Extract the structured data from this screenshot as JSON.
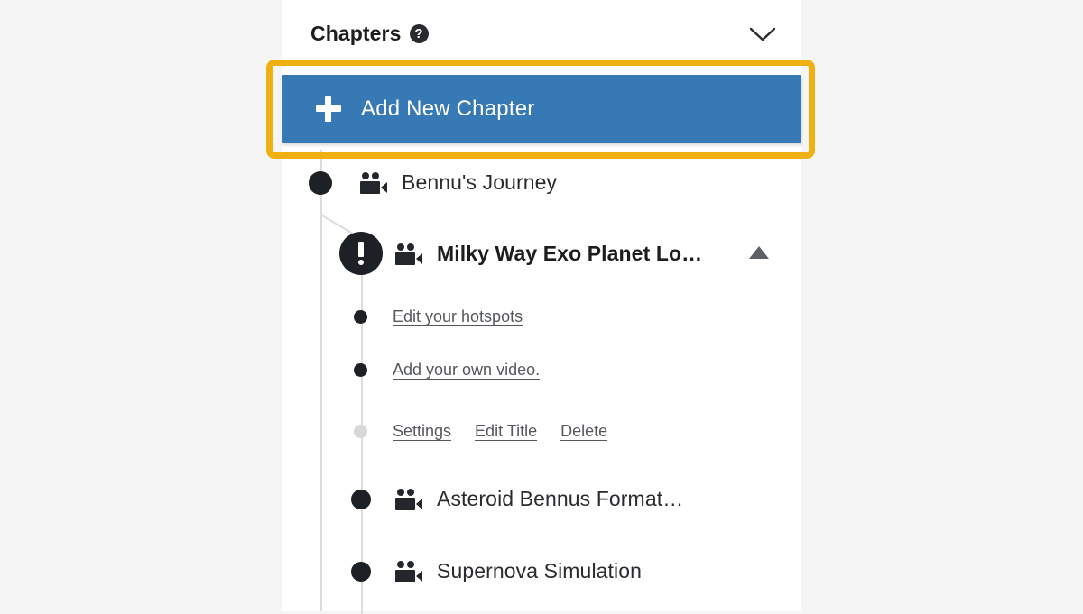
{
  "panel": {
    "header": {
      "title": "Chapters",
      "help_icon": "help-question-icon",
      "help_glyph": "?",
      "collapse_icon": "chevron-down-icon"
    },
    "add_chapter_button": {
      "label": "Add New Chapter",
      "icon": "plus-icon",
      "background_color": "#3779b4",
      "text_color": "#ffffff"
    },
    "highlight": {
      "color": "#eeb111",
      "target": "add-chapter-button"
    },
    "tree": {
      "chapters": [
        {
          "title": "Bennu's Journey",
          "icon": "video-camera-icon",
          "state": "normal",
          "bullet": "filled-dark"
        },
        {
          "title": "Milky Way Exo Planet Lo…",
          "icon": "video-camera-icon",
          "state": "active",
          "bullet": "alert-exclamation",
          "collapse_icon": "triangle-up-icon",
          "sub_items": [
            {
              "label": "Edit your hotspots",
              "bullet": "filled-dark"
            },
            {
              "label": "Add your own video.",
              "bullet": "filled-dark"
            }
          ],
          "actions": {
            "bullet": "filled-light",
            "items": [
              {
                "label": "Settings"
              },
              {
                "label": "Edit Title"
              },
              {
                "label": "Delete"
              }
            ]
          }
        },
        {
          "title": "Asteroid Bennus Format…",
          "icon": "video-camera-icon",
          "state": "normal",
          "bullet": "filled-dark"
        },
        {
          "title": "Supernova Simulation",
          "icon": "video-camera-icon",
          "state": "normal",
          "bullet": "filled-dark"
        }
      ]
    }
  },
  "colors": {
    "page_background": "#f5f5f5",
    "panel_background": "#ffffff",
    "accent_blue": "#3779b4",
    "highlight_yellow": "#eeb111",
    "node_dark": "#1d2024",
    "rail_gray": "#dcdcdc"
  }
}
